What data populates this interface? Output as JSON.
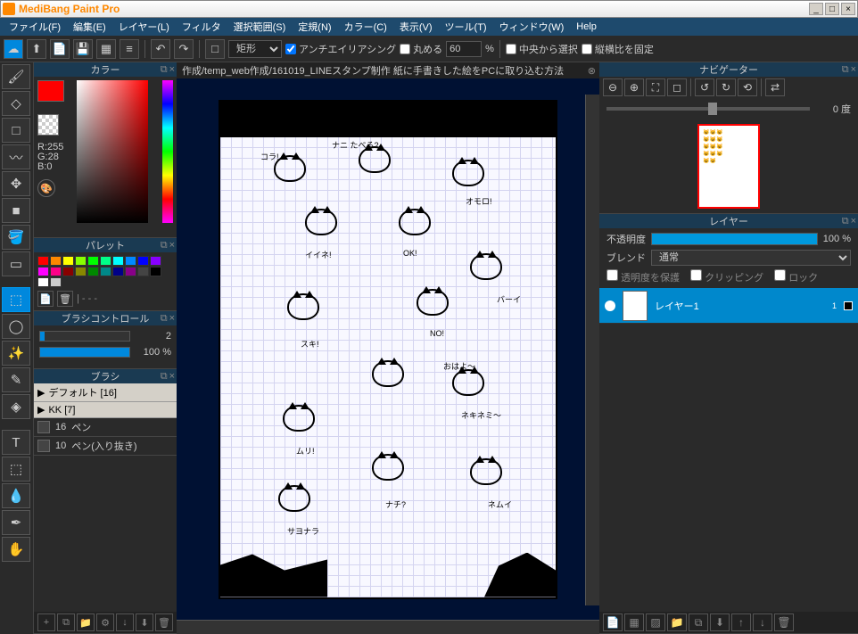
{
  "title": "MediBang Paint Pro",
  "menu": [
    "ファイル(F)",
    "編集(E)",
    "レイヤー(L)",
    "フィルタ",
    "選択範囲(S)",
    "定規(N)",
    "カラー(C)",
    "表示(V)",
    "ツール(T)",
    "ウィンドウ(W)",
    "Help"
  ],
  "toolbar": {
    "shape_select": "矩形",
    "antialias": "アンチエイリアシング",
    "round": "丸める",
    "round_val": "60",
    "percent": "%",
    "center_select": "中央から選択",
    "aspect_lock": "縦横比を固定"
  },
  "doc_tab": "作成/temp_web作成/161019_LINEスタンプ制作 紙に手書きした絵をPCに取り込む方法",
  "panels": {
    "color": "カラー",
    "palette": "パレット",
    "brush_control": "ブラシコントロール",
    "brush": "ブラシ",
    "navigator": "ナビゲーター",
    "layer": "レイヤー"
  },
  "color": {
    "r": "R:255",
    "g": "G:28",
    "b": "B:0"
  },
  "palette": {
    "colors": [
      "#ff0000",
      "#ff8800",
      "#ffff00",
      "#88ff00",
      "#00ff00",
      "#00ff88",
      "#00ffff",
      "#0088ff",
      "#0000ff",
      "#8800ff",
      "#ff00ff",
      "#ff0088",
      "#880000",
      "#888800",
      "#008800",
      "#008888",
      "#000088",
      "#880088",
      "#444444",
      "#000000",
      "#ffffff",
      "#cccccc"
    ],
    "dash": "| - - -"
  },
  "brush_control": {
    "size": "2",
    "opacity": "100 %"
  },
  "brushes": {
    "groups": [
      {
        "name": "デフォルト [16]"
      },
      {
        "name": "KK [7]"
      }
    ],
    "items": [
      {
        "size": "16",
        "name": "ペン"
      },
      {
        "size": "10",
        "name": "ペン(入り抜き)"
      }
    ]
  },
  "navigator": {
    "degree": "0 度"
  },
  "layer": {
    "opacity_label": "不透明度",
    "opacity_val": "100 %",
    "blend_label": "ブレンド",
    "blend_val": "通常",
    "protect": "透明度を保護",
    "clipping": "クリッピング",
    "lock": "ロック",
    "layer1": "レイヤー1",
    "layer1_num": "1"
  },
  "doodles": [
    "コラ!",
    "ナニ たべる?",
    "イイネ!",
    "OK!",
    "オモロ!",
    "スキ!",
    "NO!",
    "バーイ",
    "ムリ!",
    "おはよ〜",
    "ネキネミ〜",
    "サヨナラ",
    "ナチ?",
    "ネムイ"
  ]
}
